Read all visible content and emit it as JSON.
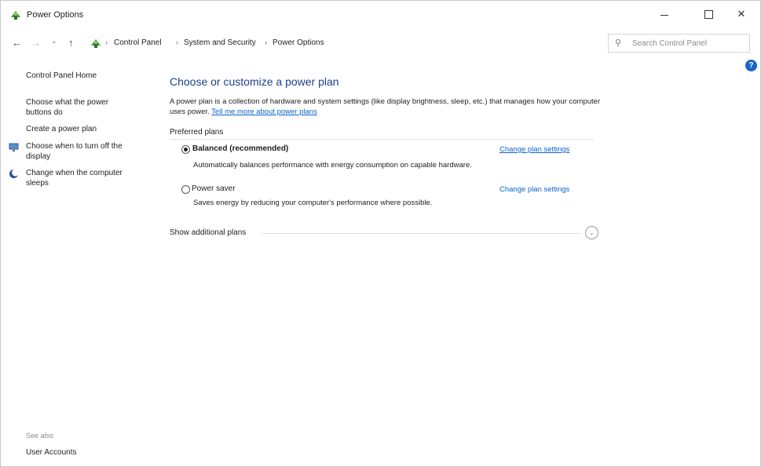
{
  "window": {
    "title": "Power Options",
    "controls": {
      "minimize": "minimize",
      "maximize": "maximize",
      "close": "✕"
    }
  },
  "nav": {
    "back": "←",
    "forward": "→",
    "recent": "⌄",
    "up": "↑",
    "separator": "›",
    "breadcrumbs": [
      "Control Panel",
      "System and Security",
      "Power Options"
    ],
    "dropdown": "⌄",
    "refresh": "↻"
  },
  "search": {
    "icon": "⚲",
    "placeholder": "Search Control Panel"
  },
  "help": {
    "label": "?"
  },
  "sidebar": {
    "home": "Control Panel Home",
    "items": [
      {
        "label": "Choose what the power buttons do",
        "icon": ""
      },
      {
        "label": "Create a power plan",
        "icon": ""
      },
      {
        "label": "Choose when to turn off the display",
        "icon": "monitor-icon"
      },
      {
        "label": "Change when the computer sleeps",
        "icon": "moon-icon"
      }
    ],
    "see_also": "See also",
    "user_accounts": "User Accounts"
  },
  "main": {
    "title": "Choose or customize a power plan",
    "description": "A power plan is a collection of hardware and system settings (like display brightness, sleep, etc.) that manages how your computer uses power.",
    "description_link": "Tell me more about power plans",
    "preferred_label": "Preferred plans",
    "plans": [
      {
        "name": "Balanced (recommended)",
        "selected": true,
        "description": "Automatically balances performance with energy consumption on capable hardware.",
        "link": "Change plan settings"
      },
      {
        "name": "Power saver",
        "selected": false,
        "description": "Saves energy by reducing your computer's performance where possible.",
        "link": "Change plan settings"
      }
    ],
    "show_additional": "Show additional plans",
    "show_additional_icon": "⌄"
  },
  "colors": {
    "title_blue": "#1e3f8a",
    "link_blue": "#0a64c8",
    "help_blue": "#1a66c7"
  }
}
